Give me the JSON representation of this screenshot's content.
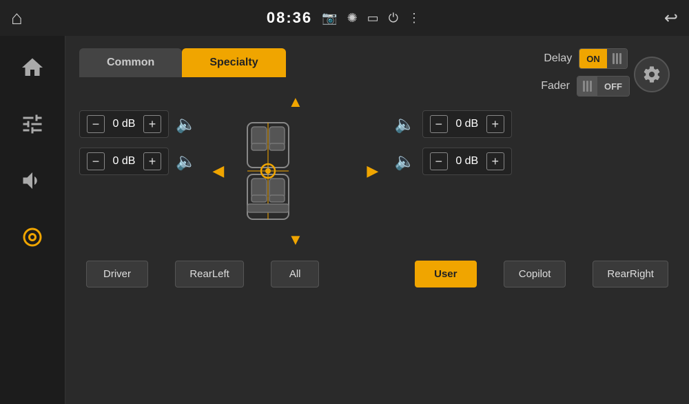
{
  "statusBar": {
    "time": "08:36",
    "icons": [
      "camera",
      "brightness",
      "battery",
      "power",
      "menu",
      "back"
    ]
  },
  "sidebar": {
    "items": [
      {
        "id": "home",
        "icon": "🏠",
        "active": false
      },
      {
        "id": "equalizer",
        "icon": "⚙",
        "active": false
      },
      {
        "id": "volume",
        "icon": "🔊",
        "active": false
      },
      {
        "id": "audio",
        "icon": "🎧",
        "active": true
      }
    ]
  },
  "tabs": {
    "common": "Common",
    "specialty": "Specialty"
  },
  "delay": {
    "label": "Delay",
    "state": "ON"
  },
  "fader": {
    "label": "Fader",
    "state": "OFF"
  },
  "controls": {
    "frontLeft": {
      "value": "0 dB"
    },
    "frontRight": {
      "value": "0 dB"
    },
    "rearLeft": {
      "value": "0 dB"
    },
    "rearRight": {
      "value": "0 dB"
    }
  },
  "buttons": {
    "driver": "Driver",
    "rearLeft": "RearLeft",
    "all": "All",
    "user": "User",
    "copilot": "Copilot",
    "rearRight": "RearRight"
  }
}
